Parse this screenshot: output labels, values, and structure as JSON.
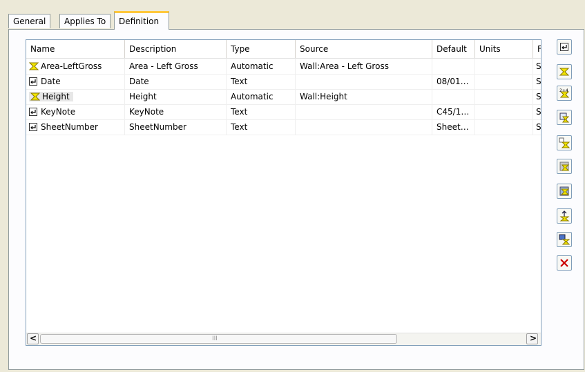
{
  "tabs": [
    "General",
    "Applies To",
    "Definition"
  ],
  "grid": {
    "columns": [
      "Name",
      "Description",
      "Type",
      "Source",
      "Default",
      "Units",
      "F"
    ],
    "rows": [
      {
        "name": "Area-LeftGross",
        "icon": "automatic-property-icon",
        "description": "Area - Left Gross",
        "type": "Automatic",
        "source": "Wall:Area - Left Gross",
        "default": "",
        "units": "",
        "f": "S|"
      },
      {
        "name": "Date",
        "icon": "text-property-icon",
        "description": "Date",
        "type": "Text",
        "source": "",
        "default": "08/01…",
        "units": "",
        "f": "S|"
      },
      {
        "name": "Height",
        "icon": "automatic-property-icon",
        "description": "Height",
        "type": "Automatic",
        "source": "Wall:Height",
        "default": "",
        "units": "",
        "f": "S|"
      },
      {
        "name": "KeyNote",
        "icon": "text-property-icon",
        "description": "KeyNote",
        "type": "Text",
        "source": "",
        "default": "C45/1…",
        "units": "",
        "f": "S|"
      },
      {
        "name": "SheetNumber",
        "icon": "text-property-icon",
        "description": "SheetNumber",
        "type": "Text",
        "source": "",
        "default": "Sheet…",
        "units": "",
        "f": "S|"
      }
    ],
    "scroll_left_arrow": "<",
    "scroll_right_arrow": ">",
    "scroll_grip": "III"
  },
  "toolbar": [
    "add-text-property-icon",
    "add-automatic-property-icon",
    "add-formula-property-icon",
    "add-anchor-property-icon",
    "add-classification-property-icon",
    "add-material-property-icon",
    "add-property-set-data-icon",
    "add-location-property-icon",
    "add-graphic-property-icon",
    "delete-icon"
  ],
  "colors": {
    "active_tab_accent": "#ffc83c",
    "delete": "#cc0000"
  }
}
